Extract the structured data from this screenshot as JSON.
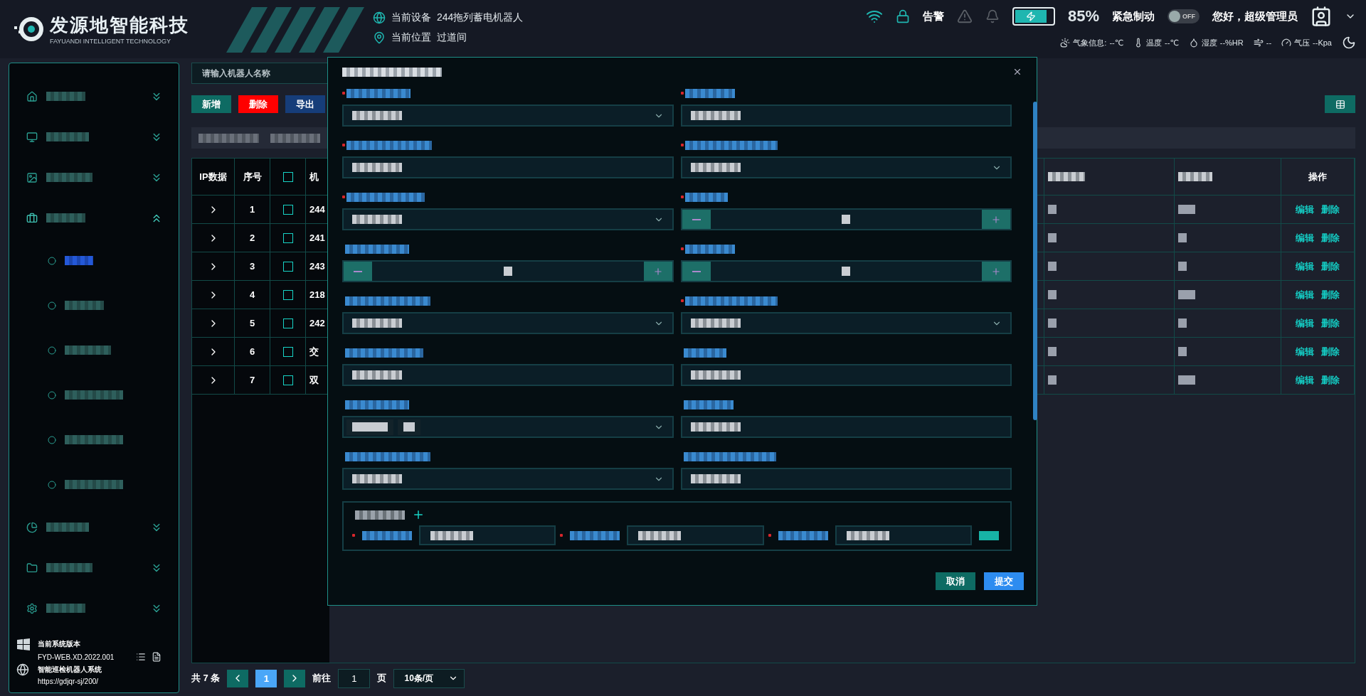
{
  "header": {
    "logo_title": "发源地智能科技",
    "logo_subtitle": "FAYUANDI INTELLIGENT TECHNOLOGY",
    "device_label": "当前设备",
    "device_value": "244拖列蓄电机器人",
    "location_label": "当前位置",
    "location_value": "过道间",
    "alarm_label": "告警",
    "battery": {
      "level": 0.85,
      "reading": "85%"
    },
    "brake_label": "紧急制动",
    "brake_switch": {
      "on": false,
      "label": "OFF"
    },
    "greeting": "您好，超级管理员",
    "weather": [
      {
        "kind": "info",
        "label": "气象信息:",
        "value": "--℃"
      },
      {
        "kind": "temperature",
        "label": "温度",
        "value": "--℃"
      },
      {
        "kind": "humidity",
        "label": "湿度",
        "value": "--%HR"
      },
      {
        "kind": "wind",
        "value": "--"
      },
      {
        "kind": "pressure",
        "label": "气压",
        "value": "--Kpa"
      }
    ]
  },
  "sidebar": {
    "items": [
      {
        "expanded": false
      },
      {
        "expanded": false
      },
      {
        "expanded": false
      },
      {
        "expanded": true,
        "children": [
          {
            "selected": true
          },
          {
            "selected": false
          },
          {
            "selected": false
          },
          {
            "selected": false
          },
          {
            "selected": false
          },
          {
            "selected": false
          }
        ]
      },
      {
        "expanded": false
      },
      {
        "expanded": false
      },
      {
        "expanded": false
      }
    ],
    "footer": {
      "version_label": "当前系统版本",
      "version": "FYD-WEB.XD.2022.001",
      "system_name": "智能巡检机器人系统",
      "url": "https://gdjqr-sj/200/"
    }
  },
  "toolbar": {
    "search_placeholder": "请输入机器人名称",
    "buttons": [
      {
        "label": "新增",
        "kind": "add"
      },
      {
        "label": "删除",
        "kind": "delete"
      },
      {
        "label": "导出",
        "kind": "export"
      }
    ]
  },
  "table": {
    "columns": [
      {
        "kind": "text",
        "label": "IP数据"
      },
      {
        "kind": "text",
        "label": "序号"
      },
      {
        "kind": "checkbox",
        "checked": false
      },
      {
        "kind": "text",
        "label": "机"
      }
    ],
    "action_column": "操作",
    "rows": [
      {
        "index": "1",
        "name": "244",
        "checked": false,
        "actions": [
          "编辑",
          "删除"
        ]
      },
      {
        "index": "2",
        "name": "241",
        "checked": false,
        "actions": [
          "编辑",
          "删除"
        ]
      },
      {
        "index": "3",
        "name": "243",
        "checked": false,
        "actions": [
          "编辑",
          "删除"
        ]
      },
      {
        "index": "4",
        "name": "218",
        "checked": false,
        "actions": [
          "编辑",
          "删除"
        ]
      },
      {
        "index": "5",
        "name": "242",
        "checked": false,
        "actions": [
          "编辑",
          "删除"
        ]
      },
      {
        "index": "6",
        "name": "交",
        "checked": false,
        "actions": [
          "编辑",
          "删除"
        ]
      },
      {
        "index": "7",
        "name": "双",
        "checked": false,
        "actions": [
          "编辑",
          "删除"
        ]
      }
    ]
  },
  "pagination": {
    "total": "共 7 条",
    "pages": [
      {
        "label": "1",
        "selected": true
      }
    ],
    "goto_label": "前往",
    "goto_value": "1",
    "page_unit": "页",
    "page_size": "10条/页"
  },
  "modal": {
    "fields": [
      {
        "kind": "select",
        "required": true
      },
      {
        "kind": "input",
        "required": true
      },
      {
        "kind": "input",
        "required": true
      },
      {
        "kind": "select",
        "required": true
      },
      {
        "kind": "select",
        "required": true
      },
      {
        "kind": "stepper",
        "required": true
      },
      {
        "kind": "stepper",
        "required": false
      },
      {
        "kind": "stepper",
        "required": true
      },
      {
        "kind": "select",
        "required": false
      },
      {
        "kind": "select",
        "required": true
      },
      {
        "kind": "input",
        "required": false
      },
      {
        "kind": "input",
        "required": false
      },
      {
        "kind": "tags",
        "required": false
      },
      {
        "kind": "input",
        "required": false
      },
      {
        "kind": "select",
        "required": false
      },
      {
        "kind": "input",
        "required": false
      }
    ],
    "charging": {
      "fields": [
        {
          "required": true
        },
        {
          "required": true
        },
        {
          "required": true
        }
      ]
    },
    "buttons": [
      {
        "label": "取消",
        "kind": "cancel"
      },
      {
        "label": "提交",
        "kind": "submit"
      }
    ]
  }
}
